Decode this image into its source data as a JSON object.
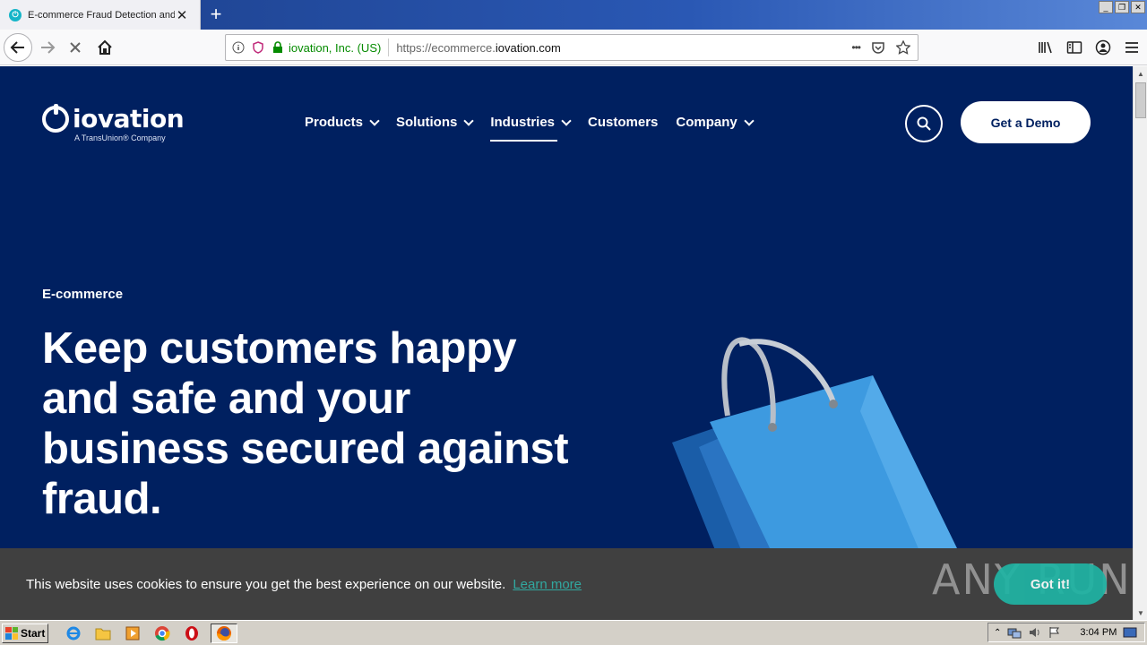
{
  "browser": {
    "tab_title": "E-commerce Fraud Detection and I",
    "new_tab_symbol": "+",
    "identity": "iovation, Inc. (US)",
    "url_prefix": "https://ecommerce.",
    "url_domain": "iovation.com",
    "url_more": "•••"
  },
  "site": {
    "logo_word": "iovation",
    "logo_sub": "A TransUnion® Company",
    "nav": [
      {
        "label": "Products",
        "dropdown": true
      },
      {
        "label": "Solutions",
        "dropdown": true
      },
      {
        "label": "Industries",
        "dropdown": true,
        "active": true
      },
      {
        "label": "Customers",
        "dropdown": false
      },
      {
        "label": "Company",
        "dropdown": true
      }
    ],
    "demo_button": "Get a Demo",
    "hero": {
      "eyebrow": "E-commerce",
      "headline": "Keep customers happy and safe and your business secured against fraud."
    },
    "colors": {
      "navy": "#002060",
      "bag_blue": "#3d9ae0",
      "accent_teal": "#1fb4a4"
    }
  },
  "cookie": {
    "message": "This website uses cookies to ensure you get the best experience on our website.",
    "link": "Learn more",
    "button": "Got it!",
    "watermark": "ANY RUN"
  },
  "taskbar": {
    "start": "Start",
    "time": "3:04 PM"
  }
}
